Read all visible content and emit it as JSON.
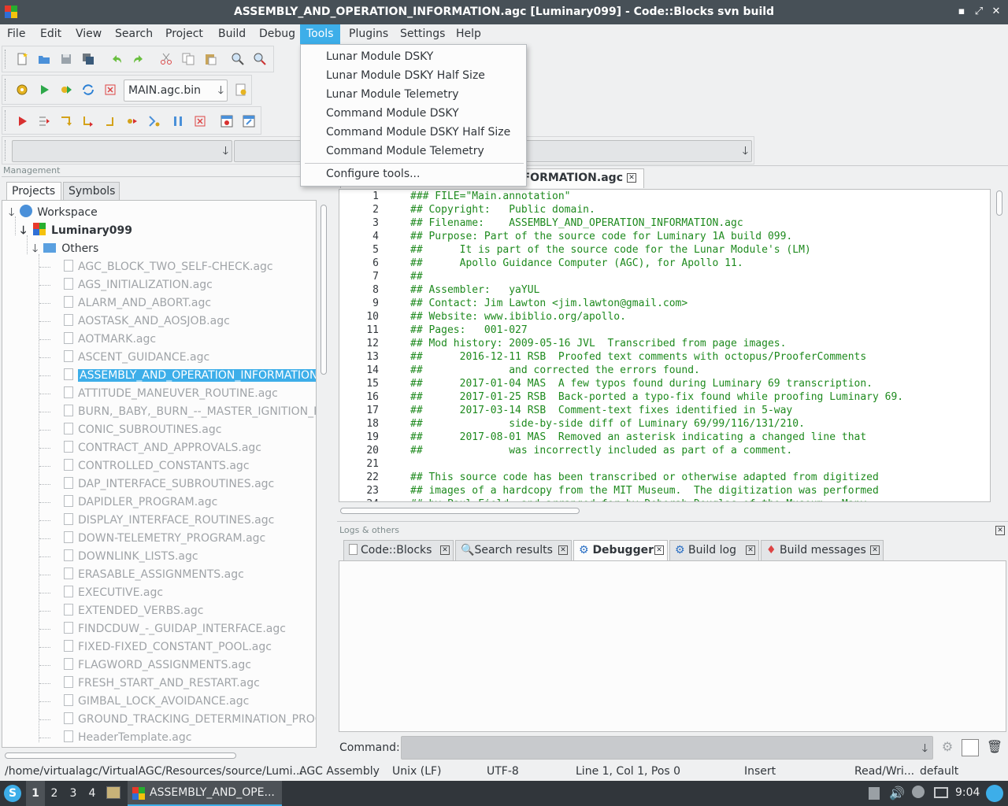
{
  "window": {
    "title": "ASSEMBLY_AND_OPERATION_INFORMATION.agc [Luminary099] - Code::Blocks svn build",
    "minimize": "▪",
    "maximize": "⤢",
    "close": "✕"
  },
  "menubar": {
    "items": [
      "File",
      "Edit",
      "View",
      "Search",
      "Project",
      "Build",
      "Debug",
      "Tools",
      "Plugins",
      "Settings",
      "Help"
    ],
    "active": "Tools"
  },
  "tools_menu": {
    "items": [
      "Lunar Module DSKY",
      "Lunar Module DSKY Half Size",
      "Lunar Module Telemetry",
      "Command Module DSKY",
      "Command Module DSKY Half Size",
      "Command Module Telemetry"
    ],
    "configure": "Configure tools..."
  },
  "build_target": "MAIN.agc.bin",
  "management": {
    "label": "Management",
    "tabs": [
      "Projects",
      "Symbols"
    ],
    "workspace": "Workspace",
    "project": "Luminary099",
    "folder": "Others",
    "files": [
      "AGC_BLOCK_TWO_SELF-CHECK.agc",
      "AGS_INITIALIZATION.agc",
      "ALARM_AND_ABORT.agc",
      "AOSTASK_AND_AOSJOB.agc",
      "AOTMARK.agc",
      "ASCENT_GUIDANCE.agc",
      "ASSEMBLY_AND_OPERATION_INFORMATION.agc",
      "ATTITUDE_MANEUVER_ROUTINE.agc",
      "BURN,_BABY,_BURN_--_MASTER_IGNITION_ROUTINE.agc",
      "CONIC_SUBROUTINES.agc",
      "CONTRACT_AND_APPROVALS.agc",
      "CONTROLLED_CONSTANTS.agc",
      "DAP_INTERFACE_SUBROUTINES.agc",
      "DAPIDLER_PROGRAM.agc",
      "DISPLAY_INTERFACE_ROUTINES.agc",
      "DOWN-TELEMETRY_PROGRAM.agc",
      "DOWNLINK_LISTS.agc",
      "ERASABLE_ASSIGNMENTS.agc",
      "EXECUTIVE.agc",
      "EXTENDED_VERBS.agc",
      "FINDCDUW_-_GUIDAP_INTERFACE.agc",
      "FIXED-FIXED_CONSTANT_POOL.agc",
      "FLAGWORD_ASSIGNMENTS.agc",
      "FRESH_START_AND_RESTART.agc",
      "GIMBAL_LOCK_AVOIDANCE.agc",
      "GROUND_TRACKING_DETERMINATION_PROGRAM.agc",
      "HeaderTemplate.agc"
    ],
    "selected_file": "ASSEMBLY_AND_OPERATION_INFORMATION.agc"
  },
  "editor": {
    "tab_label": "ASSEMBLY_AND_OPERATION_INFORMATION.agc",
    "lines": [
      {
        "n": "1",
        "t": "### FILE=\"Main.annotation\""
      },
      {
        "n": "2",
        "t": "## Copyright:   Public domain."
      },
      {
        "n": "3",
        "t": "## Filename:    ASSEMBLY_AND_OPERATION_INFORMATION.agc"
      },
      {
        "n": "4",
        "t": "## Purpose: Part of the source code for Luminary 1A build 099."
      },
      {
        "n": "5",
        "t": "##      It is part of the source code for the Lunar Module's (LM)"
      },
      {
        "n": "6",
        "t": "##      Apollo Guidance Computer (AGC), for Apollo 11."
      },
      {
        "n": "7",
        "t": "##"
      },
      {
        "n": "8",
        "t": "## Assembler:   yaYUL"
      },
      {
        "n": "9",
        "t": "## Contact: Jim Lawton <jim.lawton@gmail.com>"
      },
      {
        "n": "10",
        "t": "## Website: www.ibiblio.org/apollo."
      },
      {
        "n": "11",
        "t": "## Pages:   001-027"
      },
      {
        "n": "12",
        "t": "## Mod history: 2009-05-16 JVL  Transcribed from page images."
      },
      {
        "n": "13",
        "t": "##      2016-12-11 RSB  Proofed text comments with octopus/ProoferComments"
      },
      {
        "n": "14",
        "t": "##              and corrected the errors found."
      },
      {
        "n": "15",
        "t": "##      2017-01-04 MAS  A few typos found during Luminary 69 transcription."
      },
      {
        "n": "16",
        "t": "##      2017-01-25 RSB  Back-ported a typo-fix found while proofing Luminary 69."
      },
      {
        "n": "17",
        "t": "##      2017-03-14 RSB  Comment-text fixes identified in 5-way"
      },
      {
        "n": "18",
        "t": "##              side-by-side diff of Luminary 69/99/116/131/210."
      },
      {
        "n": "19",
        "t": "##      2017-08-01 MAS  Removed an asterisk indicating a changed line that"
      },
      {
        "n": "20",
        "t": "##              was incorrectly included as part of a comment."
      },
      {
        "n": "21",
        "t": ""
      },
      {
        "n": "22",
        "t": "## This source code has been transcribed or otherwise adapted from digitized"
      },
      {
        "n": "23",
        "t": "## images of a hardcopy from the MIT Museum.  The digitization was performed"
      },
      {
        "n": "24",
        "t": "## by Paul Fjeld, and arranged for by Deborah Douglas of the Museum.  Many"
      }
    ]
  },
  "logs": {
    "label": "Logs & others",
    "tabs": [
      "Code::Blocks",
      "Search results",
      "Debugger",
      "Build log",
      "Build messages"
    ],
    "active_tab": "Debugger",
    "command_label": "Command:"
  },
  "statusbar": {
    "path": "/home/virtualagc/VirtualAGC/Resources/source/Lumi...",
    "language": "AGC Assembly",
    "eol": "Unix (LF)",
    "encoding": "UTF-8",
    "position": "Line 1, Col 1, Pos 0",
    "mode": "Insert",
    "access": "Read/Wri...",
    "profile": "default"
  },
  "taskbar": {
    "desktops": [
      "1",
      "2",
      "3",
      "4"
    ],
    "task": "ASSEMBLY_AND_OPE...",
    "clock": "9:04"
  },
  "colors": {
    "accent": "#3daee9",
    "titlebar": "#475057",
    "comment": "#1e8a1e",
    "taskbar": "#31363b"
  }
}
